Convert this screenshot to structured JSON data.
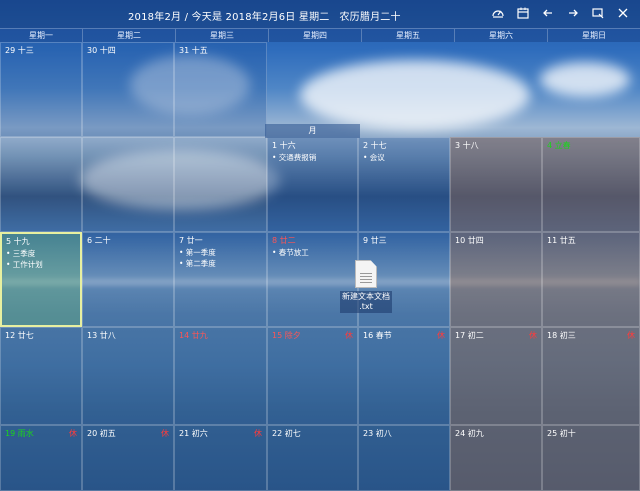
{
  "header": {
    "title": "2018年2月 / 今天是 2018年2月6日 星期二",
    "lunar": "农历腊月二十",
    "icons": [
      "dashboard-icon",
      "calendar-icon",
      "arrow-left-icon",
      "arrow-right-icon",
      "window-icon",
      "close-icon"
    ]
  },
  "weekdays": [
    "星期一",
    "星期二",
    "星期三",
    "星期四",
    "星期五",
    "星期六",
    "星期日"
  ],
  "month_label": "月",
  "rows": [
    [
      "29 十三",
      "30 十四",
      "31 十五",
      "",
      "",
      "",
      ""
    ],
    [
      "",
      "",
      "",
      "1 十六",
      "2 十七",
      "3 十八",
      "4 立春"
    ],
    [
      "5 十九",
      "6 二十",
      "7 廿一",
      "8 廿二",
      "9 廿三",
      "10 廿四",
      "11 廿五"
    ],
    [
      "12 廿七",
      "13 廿八",
      "14 廿九",
      "15 除夕",
      "16 春节",
      "17 初二",
      "18 初三"
    ],
    [
      "19 雨水",
      "20 初五",
      "21 初六",
      "22 初七",
      "23 初八",
      "24 初九",
      "25 初十"
    ]
  ],
  "events": {
    "d1": "• 交通费报销",
    "d2": "• 会议",
    "d5a": "• 三季度",
    "d5b": "• 工作计划",
    "d7a": "• 第一季度",
    "d7b": "• 第二季度",
    "d8": "• 春节放工"
  },
  "desktop_file": {
    "name": "新建文本文档",
    "ext": ".txt"
  }
}
